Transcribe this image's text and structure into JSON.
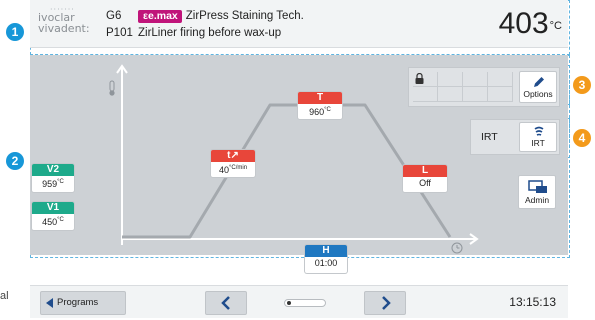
{
  "header": {
    "logo_line1": "ivoclar",
    "logo_line2": "vivadent:",
    "line1_num": "G6",
    "line1_brand": "e.max",
    "line1_text": "ZirPress Staining Tech.",
    "line2_num": "P101",
    "line2_text": "ZirLiner firing before wax-up",
    "temperature": "403",
    "temperature_unit": "°C"
  },
  "params": {
    "T": {
      "label": "T",
      "value": "960",
      "unit": "°C"
    },
    "t_rate": {
      "label": "t↗",
      "value": "40",
      "unit": "°C/min"
    },
    "L": {
      "label": "L",
      "value": "Off"
    },
    "H": {
      "label": "H",
      "value": "01:00"
    },
    "V2": {
      "label": "V2",
      "value": "959",
      "unit": "°C"
    },
    "V1": {
      "label": "V1",
      "value": "450",
      "unit": "°C"
    }
  },
  "panel": {
    "options_label": "Options",
    "irt_text": "IRT",
    "irt_button_label": "IRT",
    "admin_label": "Admin"
  },
  "badges": [
    "1",
    "2",
    "3",
    "4"
  ],
  "footer": {
    "programs_label": "Programs",
    "time": "13:15:13"
  },
  "side_label": "al",
  "colors": {
    "accent_red": "#e8463a",
    "accent_green": "#1eaa8b",
    "accent_blue": "#1f78c1",
    "badge_blue": "#1797d8",
    "badge_orange": "#f39a1b",
    "brand_magenta": "#c0147a"
  }
}
